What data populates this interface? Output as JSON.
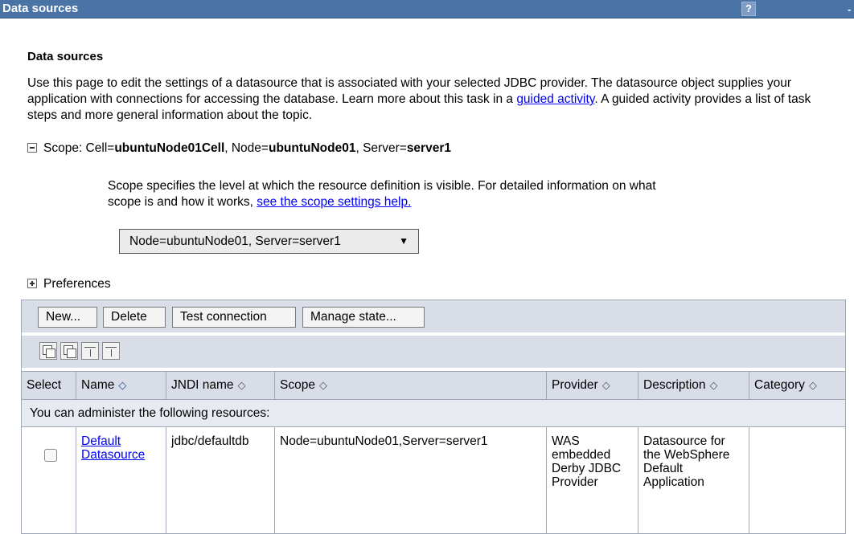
{
  "titlebar": {
    "title": "Data sources",
    "help": "?",
    "min": "-"
  },
  "page": {
    "heading": "Data sources",
    "desc_part1": "Use this page to edit the settings of a datasource that is associated with your selected JDBC provider. The datasource object supplies your application with connections for accessing the database. Learn more about this task in a ",
    "desc_link": "guided activity",
    "desc_part2": ". A guided activity provides a list of task steps and more general information about the topic."
  },
  "scope": {
    "prefix": "Scope: Cell=",
    "cell": "ubuntuNode01Cell",
    "node_label": ", Node=",
    "node": "ubuntuNode01",
    "server_label": ", Server=",
    "server": "server1",
    "help_text": "Scope specifies the level at which the resource definition is visible. For detailed information on what scope is and how it works, ",
    "help_link": "see the scope settings help.",
    "selected": "Node=ubuntuNode01, Server=server1"
  },
  "preferences": {
    "label": "Preferences"
  },
  "toolbar": {
    "new": "New...",
    "delete": "Delete",
    "test": "Test connection",
    "manage": "Manage state..."
  },
  "table": {
    "columns": [
      "Select",
      "Name",
      "JNDI name",
      "Scope",
      "Provider",
      "Description",
      "Category"
    ],
    "group_label": "You can administer the following resources:",
    "rows": [
      {
        "name": "Default Datasource",
        "jndi": "jdbc/defaultdb",
        "scope": "Node=ubuntuNode01,Server=server1",
        "provider": "WAS embedded Derby JDBC Provider",
        "description": "Datasource for the WebSphere Default Application",
        "category": ""
      }
    ]
  },
  "icons": [
    "select-all-icon",
    "deselect-all-icon",
    "show-filter-icon",
    "clear-filter-icon"
  ]
}
